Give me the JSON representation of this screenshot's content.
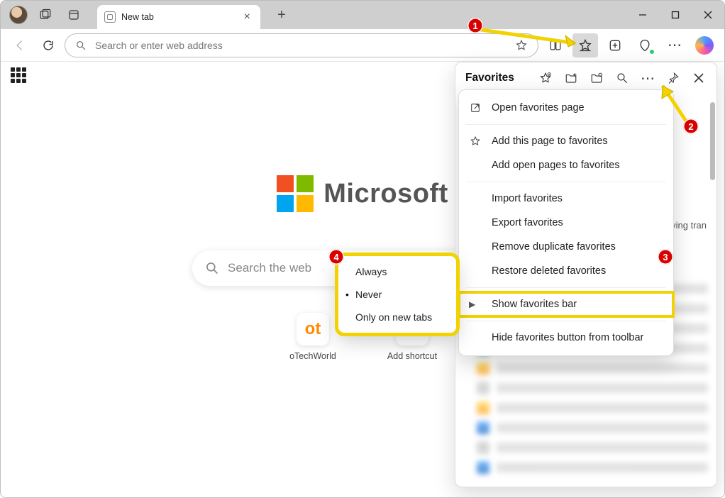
{
  "tab": {
    "title": "New tab"
  },
  "address": {
    "placeholder": "Search or enter web address"
  },
  "ntp": {
    "brand": "Microsoft",
    "search_placeholder": "Search the web",
    "tiles": [
      {
        "label": "oTechWorld",
        "glyph": "ot"
      },
      {
        "label": "Add shortcut",
        "glyph": "+"
      }
    ]
  },
  "favorites": {
    "title": "Favorites",
    "visible_text": "serving tran",
    "menu": [
      {
        "label": "Open favorites page",
        "icon": "open"
      },
      {
        "label": "Add this page to favorites",
        "icon": "add"
      },
      {
        "label": "Add open pages to favorites",
        "icon": ""
      },
      {
        "label": "Import favorites",
        "icon": ""
      },
      {
        "label": "Export favorites",
        "icon": ""
      },
      {
        "label": "Remove duplicate favorites",
        "icon": ""
      },
      {
        "label": "Restore deleted favorites",
        "icon": ""
      },
      {
        "label": "Show favorites bar",
        "icon": "",
        "submenu": true,
        "highlight": true
      },
      {
        "label": "Hide favorites button from toolbar",
        "icon": ""
      }
    ],
    "submenu": {
      "items": [
        "Always",
        "Never",
        "Only on new tabs"
      ],
      "selected": "Never"
    }
  },
  "annotations": [
    "1",
    "2",
    "3",
    "4"
  ]
}
